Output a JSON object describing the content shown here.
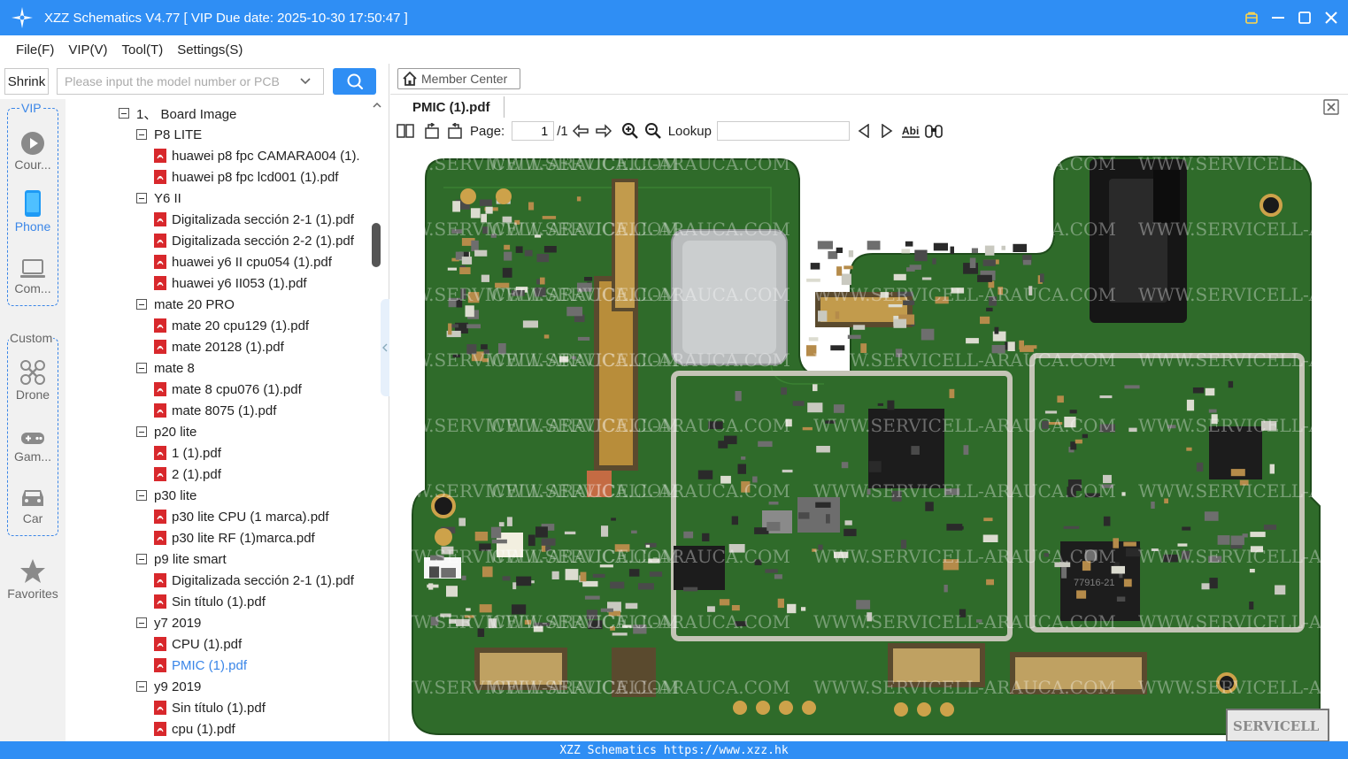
{
  "window": {
    "title": "XZZ Schematics V4.77 [ VIP Due date: 2025-10-30 17:50:47 ]"
  },
  "menu": [
    "File(F)",
    "VIP(V)",
    "Tool(T)",
    "Settings(S)"
  ],
  "sidebar": {
    "shrink_label": "Shrink",
    "search_placeholder": "Please input the model number or PCB"
  },
  "categories": {
    "vip_title": "VIP",
    "custom_title": "Custom",
    "vip": [
      {
        "label": "Cour...",
        "icon": "play-icon"
      },
      {
        "label": "Phone",
        "icon": "phone-icon",
        "active": true
      },
      {
        "label": "Com...",
        "icon": "laptop-icon"
      }
    ],
    "custom": [
      {
        "label": "Drone",
        "icon": "drone-icon"
      },
      {
        "label": "Gam...",
        "icon": "gamepad-icon"
      },
      {
        "label": "Car",
        "icon": "car-icon"
      }
    ],
    "favorites": {
      "label": "Favorites",
      "icon": "star-icon"
    }
  },
  "tree": [
    {
      "level": 0,
      "type": "folder",
      "label": "1、 Board Image"
    },
    {
      "level": 1,
      "type": "folder",
      "label": "P8 LITE"
    },
    {
      "level": 2,
      "type": "file",
      "label": "huawei p8 fpc CAMARA004 (1)."
    },
    {
      "level": 2,
      "type": "file",
      "label": "huawei p8 fpc lcd001 (1).pdf"
    },
    {
      "level": 1,
      "type": "folder",
      "label": "Y6 II"
    },
    {
      "level": 2,
      "type": "file",
      "label": "Digitalizada sección 2-1 (1).pdf"
    },
    {
      "level": 2,
      "type": "file",
      "label": "Digitalizada sección 2-2 (1).pdf"
    },
    {
      "level": 2,
      "type": "file",
      "label": "huawei y6 II cpu054 (1).pdf"
    },
    {
      "level": 2,
      "type": "file",
      "label": "huawei y6 II053 (1).pdf"
    },
    {
      "level": 1,
      "type": "folder",
      "label": "mate 20 PRO"
    },
    {
      "level": 2,
      "type": "file",
      "label": "mate 20 cpu129 (1).pdf"
    },
    {
      "level": 2,
      "type": "file",
      "label": "mate 20128 (1).pdf"
    },
    {
      "level": 1,
      "type": "folder",
      "label": "mate 8"
    },
    {
      "level": 2,
      "type": "file",
      "label": "mate 8 cpu076 (1).pdf"
    },
    {
      "level": 2,
      "type": "file",
      "label": "mate 8075 (1).pdf"
    },
    {
      "level": 1,
      "type": "folder",
      "label": "p20 lite"
    },
    {
      "level": 2,
      "type": "file",
      "label": "1 (1).pdf"
    },
    {
      "level": 2,
      "type": "file",
      "label": "2 (1).pdf"
    },
    {
      "level": 1,
      "type": "folder",
      "label": "p30 lite"
    },
    {
      "level": 2,
      "type": "file",
      "label": "p30 lite CPU (1 marca).pdf"
    },
    {
      "level": 2,
      "type": "file",
      "label": "p30 lite RF (1)marca.pdf"
    },
    {
      "level": 1,
      "type": "folder",
      "label": "p9 lite smart"
    },
    {
      "level": 2,
      "type": "file",
      "label": "Digitalizada sección 2-1 (1).pdf"
    },
    {
      "level": 2,
      "type": "file",
      "label": "Sin título (1).pdf"
    },
    {
      "level": 1,
      "type": "folder",
      "label": "y7 2019"
    },
    {
      "level": 2,
      "type": "file",
      "label": "CPU (1).pdf"
    },
    {
      "level": 2,
      "type": "file",
      "label": "PMIC (1).pdf",
      "selected": true
    },
    {
      "level": 1,
      "type": "folder",
      "label": "y9 2019"
    },
    {
      "level": 2,
      "type": "file",
      "label": "Sin título (1).pdf"
    },
    {
      "level": 2,
      "type": "file",
      "label": "cpu (1).pdf"
    }
  ],
  "main": {
    "member_center": "Member Center",
    "active_tab": "PMIC (1).pdf",
    "toolbar": {
      "page_label": "Page:",
      "page_value": "1",
      "page_total": "/1",
      "lookup_label": "Lookup",
      "lookup_value": ""
    },
    "document": {
      "watermark": "WWW.SERVICELL-ARAUCA.COM",
      "chip_marking": "77916-21",
      "corner_logo": "SERVICELL"
    }
  },
  "status": {
    "text": "XZZ Schematics https://www.xzz.hk"
  },
  "colors": {
    "accent": "#2f8ef4",
    "pcb_green": "#2f6b2a",
    "pdf_red": "#d8282c",
    "selected_text": "#3a86e8"
  }
}
